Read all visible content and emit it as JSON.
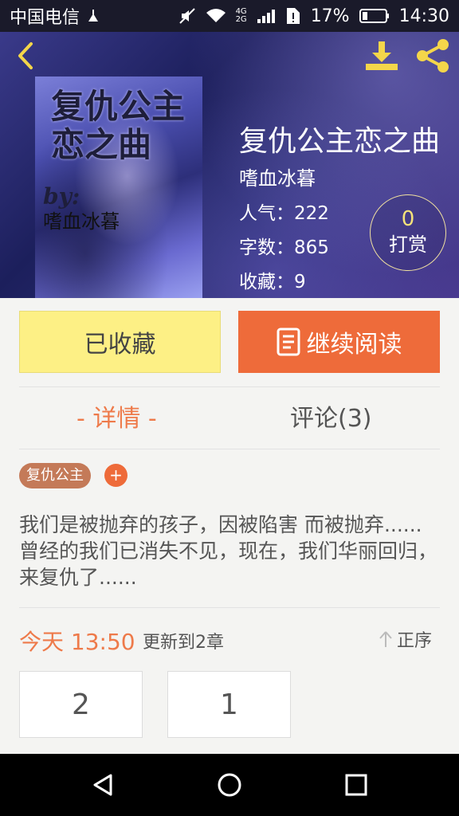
{
  "status_bar": {
    "carrier": "中国电信",
    "network": "4G\n2G",
    "battery": "17%",
    "time": "14:30"
  },
  "book": {
    "cover": {
      "title": "复仇公主恋之曲",
      "by": "by:",
      "author": "嗜血冰暮"
    },
    "title": "复仇公主恋之曲",
    "author": "嗜血冰暮",
    "stats": [
      {
        "label": "人气：",
        "value": "222"
      },
      {
        "label": "字数：",
        "value": "865"
      },
      {
        "label": "收藏：",
        "value": "9"
      }
    ],
    "reward": {
      "count": "0",
      "label": "打赏"
    }
  },
  "actions": {
    "collected_label": "已收藏",
    "continue_read_label": "继续阅读"
  },
  "tabs": {
    "detail": "- 详情 -",
    "comments": "评论(3)"
  },
  "tags": [
    {
      "label": "复仇公主"
    }
  ],
  "tag_add": "+",
  "description": "我们是被抛弃的孩子，因被陷害 而被抛弃......曾经的我们已消失不见，现在，我们华丽回归，来复仇了......",
  "update": {
    "time": "今天 13:50",
    "text": "更新到2章",
    "sort_label": "正序"
  },
  "chapters": [
    "2",
    "1"
  ],
  "colors": {
    "accent": "#ee6b3a",
    "collected_bg": "#fdf085",
    "tag_bg": "#c47a58",
    "header_bg": "#2a2d70"
  }
}
